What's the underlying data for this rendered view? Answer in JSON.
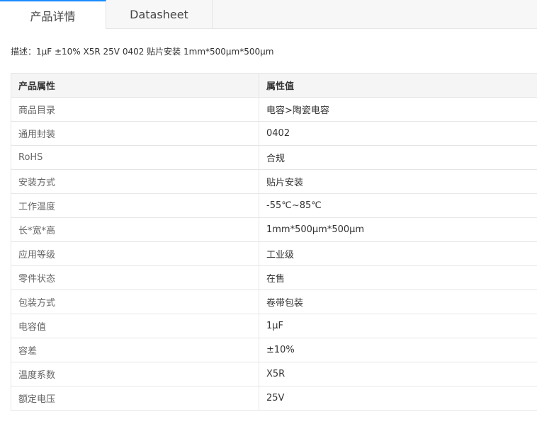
{
  "tabs": [
    {
      "label": "产品详情",
      "active": true
    },
    {
      "label": "Datasheet",
      "active": false
    }
  ],
  "description": "描述：1μF ±10% X5R 25V 0402 贴片安装 1mm*500μm*500μm",
  "table": {
    "headers": [
      "产品属性",
      "属性值"
    ],
    "rows": [
      {
        "name": "商品目录",
        "value": "电容>陶瓷电容"
      },
      {
        "name": "通用封装",
        "value": "0402"
      },
      {
        "name": "RoHS",
        "value": "合规"
      },
      {
        "name": "安装方式",
        "value": "贴片安装"
      },
      {
        "name": "工作温度",
        "value": "-55℃~85℃"
      },
      {
        "name": "长*宽*高",
        "value": "1mm*500μm*500μm"
      },
      {
        "name": "应用等级",
        "value": "工业级"
      },
      {
        "name": "零件状态",
        "value": "在售"
      },
      {
        "name": "包装方式",
        "value": "卷带包装"
      },
      {
        "name": "电容值",
        "value": "1μF"
      },
      {
        "name": "容差",
        "value": "±10%"
      },
      {
        "name": "温度系数",
        "value": "X5R"
      },
      {
        "name": "额定电压",
        "value": "25V"
      }
    ]
  },
  "colors": {
    "tab_active_border": "#1a8cff",
    "header_bg": "#f5f5f5",
    "border": "#e6e6e6"
  }
}
